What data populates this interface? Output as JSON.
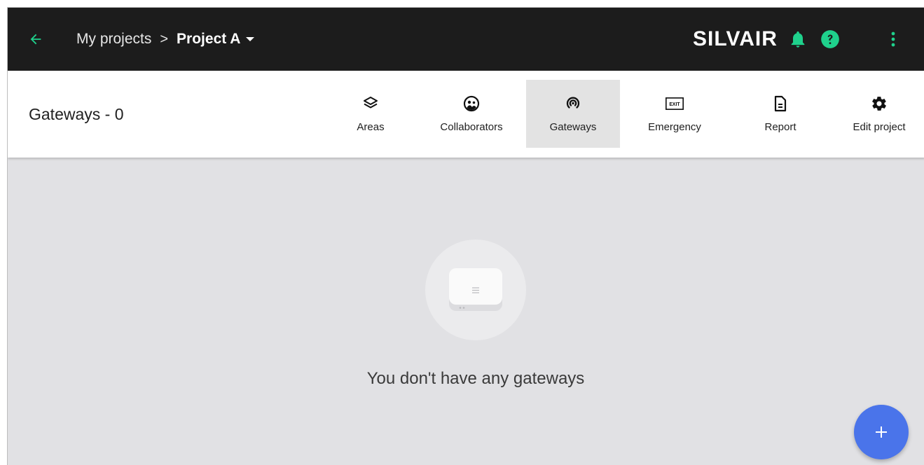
{
  "topbar": {
    "breadcrumb_root": "My projects",
    "breadcrumb_separator": ">",
    "project_name": "Project A",
    "brand": "SILVAIR",
    "icons": {
      "back": "arrow-left-icon",
      "dropdown": "caret-down-icon",
      "notifications": "bell-icon",
      "help": "help-circle-icon",
      "more": "more-vertical-icon"
    },
    "accent_color": "#1fd18c"
  },
  "header": {
    "page_title": "Gateways - 0",
    "tabs": [
      {
        "label": "Areas",
        "icon": "layers-icon",
        "active": false
      },
      {
        "label": "Collaborators",
        "icon": "collaborators-icon",
        "active": false
      },
      {
        "label": "Gateways",
        "icon": "gateway-signal-icon",
        "active": true
      },
      {
        "label": "Emergency",
        "icon": "exit-sign-icon",
        "active": false
      },
      {
        "label": "Report",
        "icon": "document-icon",
        "active": false
      },
      {
        "label": "Edit project",
        "icon": "gear-icon",
        "active": false
      }
    ],
    "exit_sign_text": "EXIT"
  },
  "main": {
    "empty_state_text": "You don't have any gateways",
    "empty_state_icon": "gateway-device-icon",
    "fab_icon": "plus-icon",
    "fab_color": "#4a74ea"
  }
}
